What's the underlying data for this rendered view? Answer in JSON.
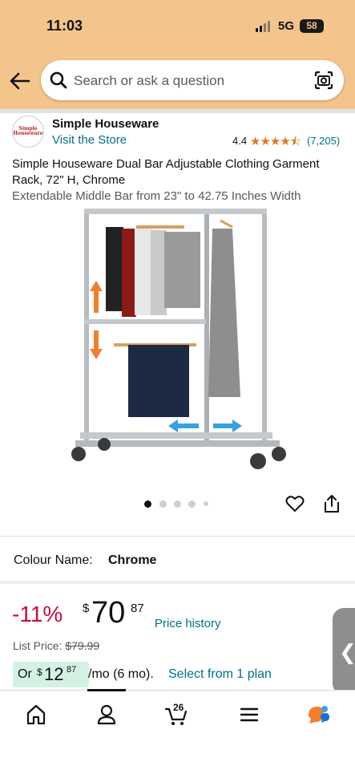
{
  "status_bar": {
    "time": "11:03",
    "network": "5G",
    "battery": "58"
  },
  "search": {
    "placeholder": "Search or ask a question"
  },
  "seller": {
    "logo_text": "Simple Houseware",
    "name": "Simple Houseware",
    "visit_link": "Visit the Store",
    "rating": "4.4",
    "stars": "★★★★⯪",
    "rating_count": "(7,205)"
  },
  "product": {
    "title": "Simple Houseware Dual Bar Adjustable Clothing Garment Rack, 72\" H, Chrome",
    "subtitle": "Extendable Middle Bar from 23\" to 42.75 Inches Width",
    "image_count": 5,
    "active_image": 1
  },
  "variant": {
    "label": "Colour Name:",
    "value": "Chrome"
  },
  "pricing": {
    "discount": "-11%",
    "currency": "$",
    "price_whole": "70",
    "price_fraction": "87",
    "price_history_link": "Price history",
    "list_price_label": "List Price:",
    "list_price_value": "$79.99"
  },
  "installment": {
    "prefix": "Or",
    "currency": "$",
    "whole": "12",
    "fraction": "87",
    "term": "/mo (6 mo).",
    "link": "Select from 1 plan"
  },
  "side_tab": {
    "icon": "chevron-left-icon",
    "glyph": "❮"
  },
  "bottom_nav": {
    "items": [
      "home-icon",
      "account-icon",
      "cart-icon",
      "menu-icon",
      "rufus-icon"
    ],
    "cart_count": "26",
    "active_index": 1
  },
  "colors": {
    "header_bg": "#f3c58c",
    "link": "#007185",
    "discount": "#cc0c39",
    "star": "#de7921",
    "installment_bg": "#d3f2e4"
  }
}
